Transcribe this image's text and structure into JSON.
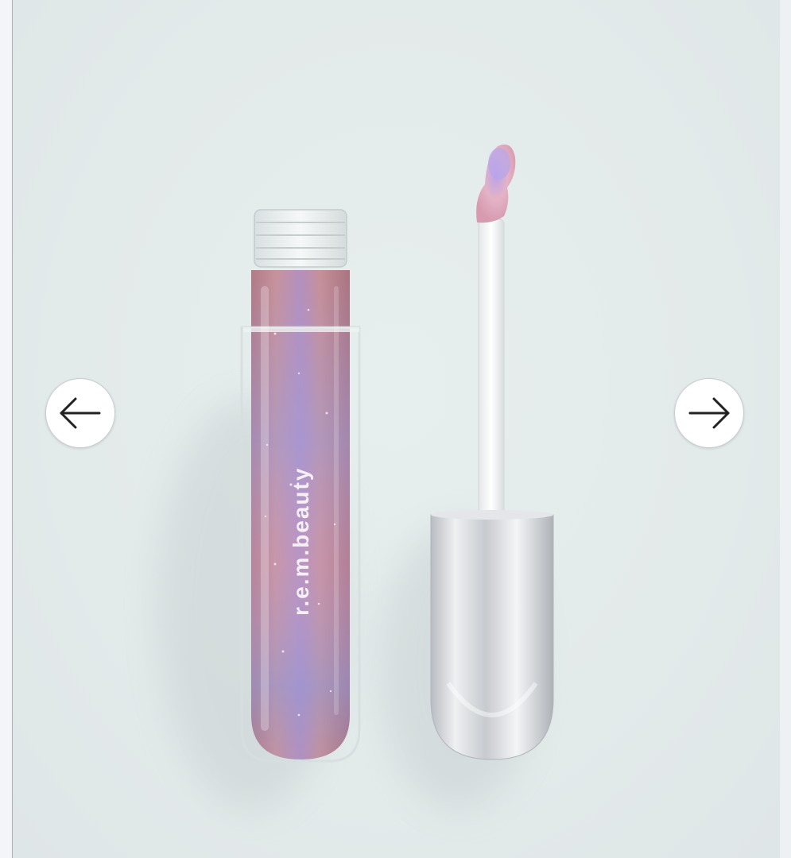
{
  "gallery": {
    "product_image": {
      "brand_label": "r.e.m.beauty",
      "colors": {
        "gloss_base": "#c48a92",
        "shimmer": "#9a8ed6",
        "cap_silver": "#c9ccd0",
        "applicator_tip": "#e7b7c4"
      }
    },
    "prev_button": {
      "icon": "arrow-left-icon"
    },
    "next_button": {
      "icon": "arrow-right-icon"
    }
  }
}
